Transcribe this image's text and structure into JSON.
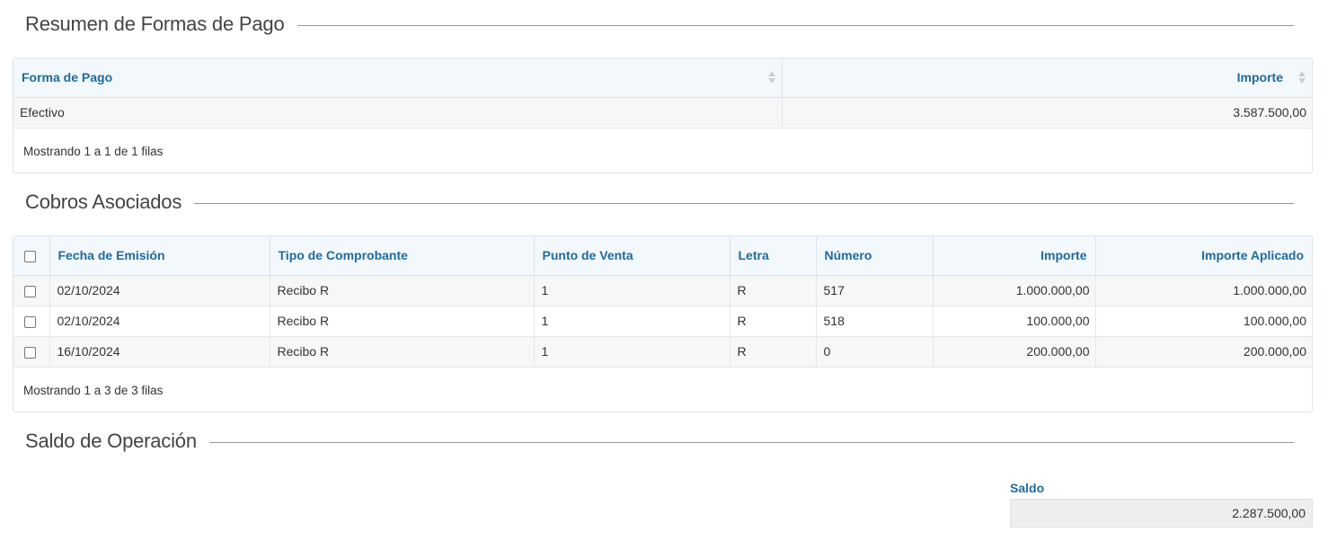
{
  "sections": {
    "payments_title": "Resumen de Formas de Pago",
    "collections_title": "Cobros Asociados",
    "balance_title": "Saldo de Operación"
  },
  "payments_table": {
    "headers": {
      "forma": "Forma de Pago",
      "importe": "Importe"
    },
    "rows": [
      {
        "forma": "Efectivo",
        "importe": "3.587.500,00"
      }
    ],
    "footer": "Mostrando 1 a 1 de 1 filas"
  },
  "collections_table": {
    "headers": {
      "fecha": "Fecha de Emisión",
      "tipo": "Tipo de Comprobante",
      "punto": "Punto de Venta",
      "letra": "Letra",
      "numero": "Número",
      "importe": "Importe",
      "aplicado": "Importe Aplicado"
    },
    "rows": [
      {
        "fecha": "02/10/2024",
        "tipo": "Recibo R",
        "punto": "1",
        "letra": "R",
        "numero": "517",
        "importe": "1.000.000,00",
        "aplicado": "1.000.000,00"
      },
      {
        "fecha": "02/10/2024",
        "tipo": "Recibo R",
        "punto": "1",
        "letra": "R",
        "numero": "518",
        "importe": "100.000,00",
        "aplicado": "100.000,00"
      },
      {
        "fecha": "16/10/2024",
        "tipo": "Recibo R",
        "punto": "1",
        "letra": "R",
        "numero": "0",
        "importe": "200.000,00",
        "aplicado": "200.000,00"
      }
    ],
    "footer": "Mostrando 1 a 3 de 3 filas"
  },
  "balance": {
    "label": "Saldo",
    "value": "2.287.500,00"
  },
  "colors": {
    "header_text": "#1d6b9e",
    "header_bg": "#f3f8fc",
    "stripe_bg": "#f7f7f7",
    "readonly_bg": "#eeeeee"
  },
  "icons": {
    "sort": "sort-icon",
    "checkbox": "checkbox-icon"
  }
}
